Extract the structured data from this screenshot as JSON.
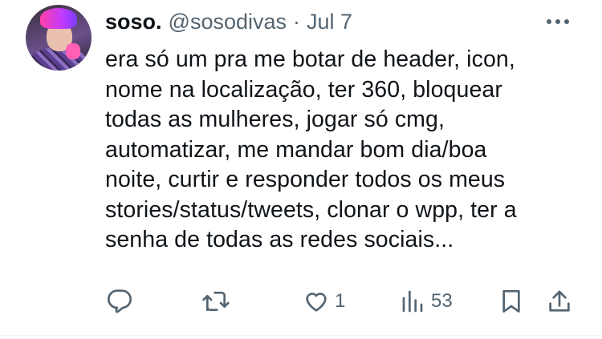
{
  "tweet": {
    "display_name": "soso.",
    "handle": "@sosodivas",
    "separator": "·",
    "date": "Jul 7",
    "text_lines": [
      "era só um pra me botar de header, icon,",
      "nome na localização, ter 360, bloquear",
      "todas as mulheres, jogar só cmg,",
      "automatizar, me mandar bom dia/boa",
      "noite, curtir e responder todos os meus",
      "stories/status/tweets, clonar o wpp, ter a",
      "senha de todas as redes sociais..."
    ]
  },
  "actions": {
    "reply": {
      "icon": "reply-icon",
      "count": ""
    },
    "retweet": {
      "icon": "retweet-icon",
      "count": ""
    },
    "like": {
      "icon": "heart-icon",
      "count": "1"
    },
    "views": {
      "icon": "views-icon",
      "count": "53"
    },
    "bookmark": {
      "icon": "bookmark-icon"
    },
    "share": {
      "icon": "share-icon"
    }
  },
  "colors": {
    "text": "#0f1419",
    "secondary": "#536471",
    "divider": "#eff3f4"
  }
}
